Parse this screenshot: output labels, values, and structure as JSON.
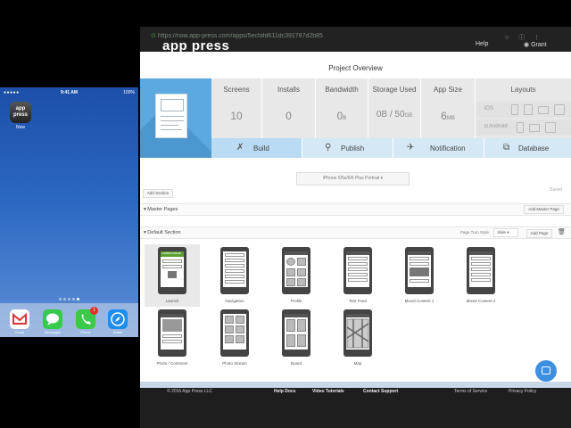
{
  "phone": {
    "status": {
      "carrier": "●●●●● ",
      "time": "9:41 AM",
      "battery": "100%"
    },
    "home_app": {
      "icon_text": "app press",
      "label": "Now"
    },
    "dock": [
      {
        "label": "Gmail",
        "icon": "gmail-icon",
        "color": "#ffffff"
      },
      {
        "label": "Messages",
        "icon": "messages-icon",
        "color": "#37c94b"
      },
      {
        "label": "Phone",
        "icon": "phone-icon",
        "color": "#3bc94a",
        "badge": "1"
      },
      {
        "label": "Safari",
        "icon": "safari-icon",
        "color": "#1f8cf0"
      }
    ]
  },
  "browser": {
    "url": "https://now.app-press.com/apps/5ecfafd611dc391787d2b85",
    "brand": "app press",
    "help": "Help",
    "user": "Grant",
    "page_title": "Project Overview",
    "stats": [
      {
        "label": "Screens",
        "value": "10",
        "unit": ""
      },
      {
        "label": "Installs",
        "value": "0",
        "unit": ""
      },
      {
        "label": "Bandwidth",
        "value": "0",
        "unit": "B"
      },
      {
        "label": "Storage Used",
        "value": "0B / 50",
        "unit": "GB"
      },
      {
        "label": "App Size",
        "value": "6",
        "unit": "MB"
      }
    ],
    "layouts": {
      "label": "Layouts",
      "os": [
        "iOS",
        "Android"
      ]
    },
    "tabs": [
      {
        "label": "Build",
        "icon": "wrench-icon"
      },
      {
        "label": "Publish",
        "icon": "satellite-icon"
      },
      {
        "label": "Notification",
        "icon": "paper-plane-icon"
      },
      {
        "label": "Database",
        "icon": "database-icon"
      }
    ],
    "device_select": "iPhone 5/5s/6/6 Plus Portrait ▾",
    "saved": "Saved",
    "add_section": "Add Section",
    "master_pages": {
      "name": "▾ Master Pages",
      "add": "Add Master Page"
    },
    "default_section": {
      "name": "▾ Default Section",
      "flip_label": "Page Turn Style",
      "flip_value": "Slide ▾",
      "add": "Add Page"
    },
    "screens": [
      {
        "caption": "Launch",
        "banner": "LAUNCH PAGE"
      },
      {
        "caption": "Navigation"
      },
      {
        "caption": "Profile"
      },
      {
        "caption": "Text Feed"
      },
      {
        "caption": "Mixed Content 1"
      },
      {
        "caption": "Mixed Content 2"
      },
      {
        "caption": "Photo / Comment"
      },
      {
        "caption": "Photo Stream"
      },
      {
        "caption": "Board"
      },
      {
        "caption": "Map"
      }
    ],
    "footer": {
      "copyright": "© 2016 App Press LLC",
      "links": [
        "Help Docs",
        "Video Tutorials",
        "Contact Support"
      ],
      "legal": [
        "Terms of Service",
        "Privacy Policy"
      ]
    }
  }
}
